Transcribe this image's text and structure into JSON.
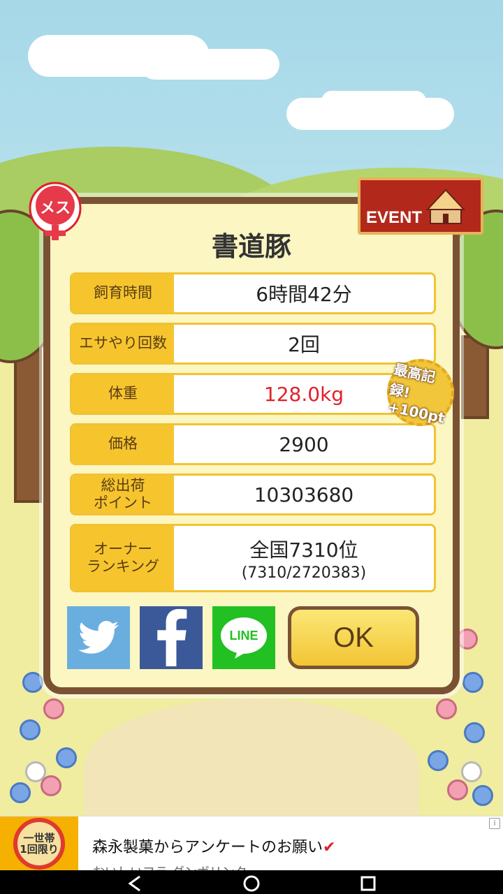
{
  "pig": {
    "name": "書道豚",
    "gender_label": "メス"
  },
  "event": {
    "label": "EVENT"
  },
  "stats": [
    {
      "label": "飼育時間",
      "value": "6時間42分"
    },
    {
      "label": "エサやり回数",
      "value": "2回"
    },
    {
      "label": "体重",
      "value": "128.0kg",
      "highlight": "#e0202a"
    },
    {
      "label": "価格",
      "value": "2900"
    },
    {
      "label_line1": "総出荷",
      "label_line2": "ポイント",
      "value": "10303680"
    },
    {
      "label_line1": "オーナー",
      "label_line2": "ランキング",
      "value": "全国7310位",
      "sub": "(7310/2720383)"
    }
  ],
  "record_badge": {
    "line1": "最高記録!",
    "line2": "+100pt"
  },
  "social": {
    "line_label": "LINE"
  },
  "ok_label": "OK",
  "ad": {
    "badge_line1": "一世帯",
    "badge_line2": "1回限り",
    "title": "森永製菓からアンケートのお願い",
    "check_mark": "✔",
    "subtitle": "おいしいフラ ダンボリンク",
    "info": "i"
  },
  "colors": {
    "accent": "#f6c52e",
    "frame": "#7a5233",
    "panel": "#fbf6c2"
  }
}
